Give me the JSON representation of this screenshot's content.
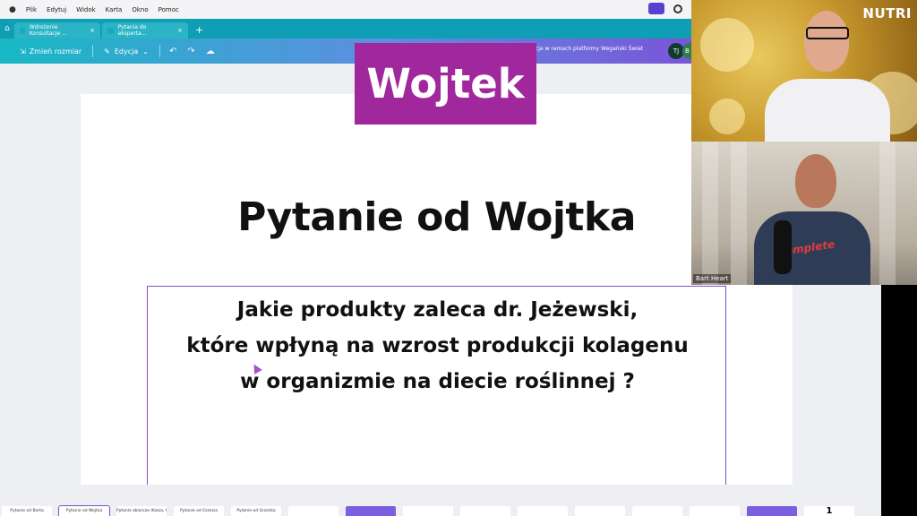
{
  "menubar": {
    "items": [
      "Plik",
      "Edytuj",
      "Widok",
      "Karta",
      "Okno",
      "Pomoc"
    ]
  },
  "tabs": [
    {
      "label": "Wdrożenie Konsultacje ...",
      "active": false
    },
    {
      "label": "Pytania do eksperta...",
      "active": true
    }
  ],
  "toolbar": {
    "resize_label": "Zmień rozmiar",
    "edit_label": "Edycja",
    "doc_title": "cje w ramach platformy Wegański Świat",
    "avatar_initials": "TJ",
    "avatar2_initial": "B"
  },
  "banner": {
    "name": "Wojtek"
  },
  "slide": {
    "title": "Pytanie od Wojtka",
    "question_lines": [
      "Jakie produkty zaleca dr. Jeżewski,",
      "które wpłyną na wzrost produkcji kolagenu",
      "w organizmie na diecie roślinnej ?"
    ]
  },
  "thumbnails": [
    {
      "label": "Pytanie od Barta",
      "selected": false,
      "style": "plain"
    },
    {
      "label": "Pytanie od Wojtka",
      "selected": true,
      "style": "plain"
    },
    {
      "label": "Pytanie zbiorcze (Kasia, Grzesiek, Stasek)",
      "selected": false,
      "style": "plain"
    },
    {
      "label": "Pytanie od Grzesia",
      "selected": false,
      "style": "plain"
    },
    {
      "label": "Pytanie od Grześka",
      "selected": false,
      "style": "plain"
    },
    {
      "label": "",
      "selected": false,
      "style": "plain"
    },
    {
      "label": "",
      "selected": false,
      "style": "dark"
    },
    {
      "label": "",
      "selected": false,
      "style": "plain"
    },
    {
      "label": "",
      "selected": false,
      "style": "plain"
    },
    {
      "label": "",
      "selected": false,
      "style": "plain"
    },
    {
      "label": "",
      "selected": false,
      "style": "plain"
    },
    {
      "label": "",
      "selected": false,
      "style": "plain"
    },
    {
      "label": "",
      "selected": false,
      "style": "plain"
    },
    {
      "label": "",
      "selected": false,
      "style": "dark"
    },
    {
      "label": "1",
      "selected": false,
      "style": "page"
    }
  ],
  "webcam": {
    "logo": "NUTRI",
    "participant2_name": "Bart Heart",
    "shirt_text": "Complete"
  }
}
